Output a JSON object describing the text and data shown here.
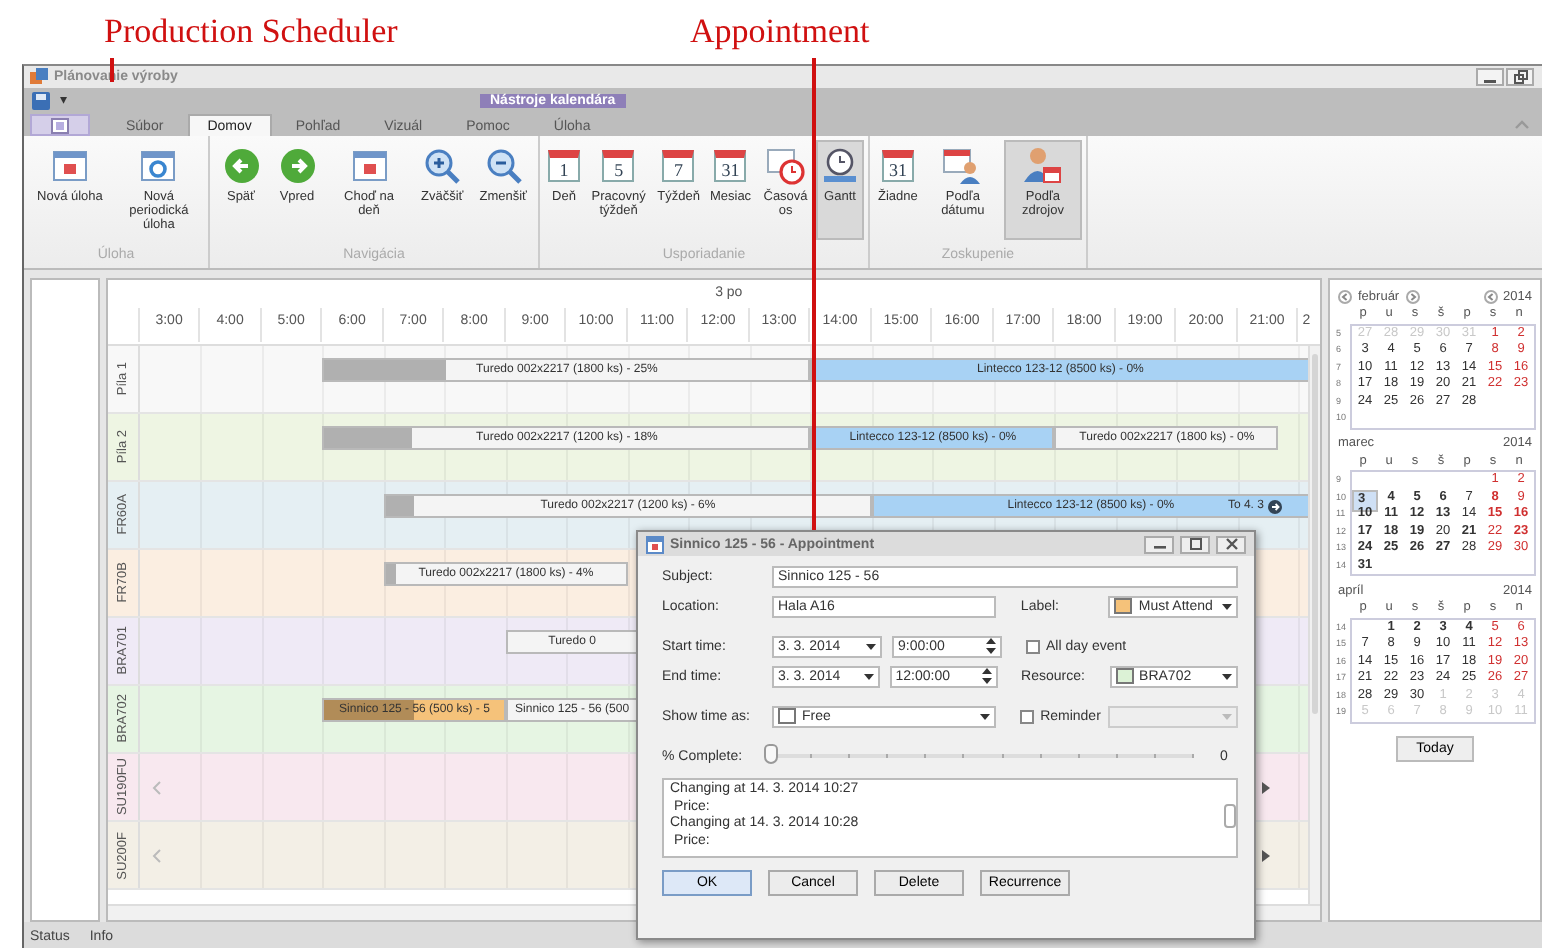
{
  "annotations": [
    {
      "text": "Production Scheduler"
    },
    {
      "text": "Appointment"
    }
  ],
  "window": {
    "title": "Plánovanie výroby",
    "context_title": "Nástroje kalendára",
    "qat_dropdown": "▾"
  },
  "tabs": [
    {
      "label": "Súbor",
      "selected": false
    },
    {
      "label": "Domov",
      "selected": true
    },
    {
      "label": "Pohľad",
      "selected": false
    },
    {
      "label": "Vizuál",
      "selected": false
    },
    {
      "label": "Pomoc",
      "selected": false
    },
    {
      "label": "Úloha",
      "selected": false
    }
  ],
  "ribbon": [
    {
      "label": "Úloha",
      "buttons": [
        {
          "kind": "task",
          "label": "Nová úloha",
          "selected": false
        },
        {
          "kind": "recurring",
          "label": "Nová periodická úloha",
          "selected": false
        }
      ]
    },
    {
      "label": "Navigácia",
      "buttons": [
        {
          "kind": "back",
          "label": "Späť",
          "selected": false
        },
        {
          "kind": "forward",
          "label": "Vpred",
          "selected": false
        },
        {
          "kind": "goto",
          "label": "Choď na deň",
          "selected": false
        },
        {
          "kind": "zoom-in",
          "label": "Zväčšiť",
          "selected": false
        },
        {
          "kind": "zoom-out",
          "label": "Zmenšiť",
          "selected": false
        }
      ]
    },
    {
      "label": "Usporiadanie",
      "buttons": [
        {
          "kind": "calendar",
          "icon_text": "1",
          "label": "Deň",
          "selected": false
        },
        {
          "kind": "calendar",
          "icon_text": "5",
          "label": "Pracovný týždeň",
          "selected": false
        },
        {
          "kind": "calendar",
          "icon_text": "7",
          "label": "Týždeň",
          "selected": false
        },
        {
          "kind": "calendar",
          "icon_text": "31",
          "label": "Mesiac",
          "selected": false
        },
        {
          "kind": "timeline",
          "label": "Časová os",
          "selected": false
        },
        {
          "kind": "gantt",
          "label": "Gantt",
          "selected": true
        }
      ]
    },
    {
      "label": "Zoskupenie",
      "buttons": [
        {
          "kind": "group-none",
          "icon_text": "31",
          "label": "Žiadne",
          "selected": false
        },
        {
          "kind": "group-date",
          "label": "Podľa dátumu",
          "selected": false
        },
        {
          "kind": "group-resource",
          "label": "Podľa zdrojov",
          "selected": true
        }
      ]
    }
  ],
  "scheduler": {
    "day": "3 po",
    "hours": [
      "3:00",
      "4:00",
      "5:00",
      "6:00",
      "7:00",
      "8:00",
      "9:00",
      "10:00",
      "11:00",
      "12:00",
      "13:00",
      "14:00",
      "15:00",
      "16:00",
      "17:00",
      "18:00",
      "19:00",
      "20:00",
      "21:00",
      "2"
    ],
    "rows": [
      {
        "name": "Píla 1",
        "color": "#f8f8f8",
        "overflow": false,
        "bars": [
          {
            "label": "Turedo 002x2217 (1800 ks) - 25%",
            "level": 0.25,
            "color": "#f4f4f4"
          },
          {
            "label": "Lintecco 123-12 (8500 ks) - 0%",
            "color": "#a8d2f4"
          }
        ]
      },
      {
        "name": "Píla 2",
        "color": "#eef5e3",
        "overflow": false,
        "bars": [
          {
            "label": "Turedo 002x2217 (1200 ks) - 18%",
            "level": 0.18,
            "color": "#f4f4f4"
          },
          {
            "label": "Lintecco 123-12 (8500 ks) - 0%",
            "color": "#a8d2f4"
          },
          {
            "label": "Turedo 002x2217 (1800 ks) - 0%",
            "color": "#f4f4f4"
          }
        ]
      },
      {
        "name": "FR60A",
        "color": "#e5eff3",
        "overflow": false,
        "bars": [
          {
            "label": "Turedo 002x2217 (1200 ks) - 6%",
            "level": 0.06,
            "color": "#f4f4f4"
          },
          {
            "label": "Lintecco 123-12 (8500 ks) - 0%",
            "color": "#a8d2f4",
            "continuation": "To 4. 3"
          }
        ]
      },
      {
        "name": "FR70B",
        "color": "#fbeee1",
        "overflow": false,
        "bars": [
          {
            "label": "Turedo 002x2217 (1800 ks) - 4%",
            "level": 0.04,
            "color": "#f4f4f4"
          }
        ]
      },
      {
        "name": "BRA701",
        "color": "#efeaf6",
        "overflow": false,
        "bars": [
          {
            "label": "Turedo 0",
            "color": "#f4f4f4"
          }
        ]
      },
      {
        "name": "BRA702",
        "color": "#e6f5e3",
        "overflow": false,
        "bars": [
          {
            "label": "Sinnico 125 - 56 (500 ks) - 5",
            "level": 0.5,
            "color": "#f5c27a"
          },
          {
            "label": "Sinnico 125 - 56 (500",
            "color": "#f4f4f4"
          }
        ]
      },
      {
        "name": "SU190FU",
        "color": "#f8e8ef",
        "overflow": true
      },
      {
        "name": "SU200F",
        "color": "#f3efe6",
        "overflow": true
      }
    ]
  },
  "dialog": {
    "title": "Sinnico 125 - 56 - Appointment",
    "subject": {
      "label": "Subject:",
      "value": "Sinnico 125 - 56"
    },
    "location": {
      "label": "Location:",
      "value": "Hala A16"
    },
    "label_field": {
      "label": "Label:",
      "value": "Must Attend",
      "color": "#f5c27a"
    },
    "start": {
      "label": "Start time:",
      "date": "3. 3. 2014",
      "time": "9:00:00"
    },
    "end": {
      "label": "End time:",
      "date": "3. 3. 2014",
      "time": "12:00:00"
    },
    "all_day": {
      "label": "All day event",
      "checked": false
    },
    "resource": {
      "label": "Resource:",
      "value": "BRA702",
      "color": "#dcf2d6"
    },
    "show_as": {
      "label": "Show time as:",
      "value": "Free",
      "color": "#ffffff"
    },
    "reminder": {
      "label": "Reminder",
      "checked": false,
      "disabled": true
    },
    "complete": {
      "label": "% Complete:",
      "level": 0,
      "reading": "0"
    },
    "notes": [
      "Changing at 14. 3. 2014 10:27",
      " Price:",
      "Changing at 14. 3. 2014 10:28",
      " Price:"
    ],
    "buttons": [
      {
        "label": "OK",
        "default": true
      },
      {
        "label": "Cancel",
        "default": false
      },
      {
        "label": "Delete",
        "default": false
      },
      {
        "label": "Recurrence",
        "default": false
      }
    ]
  },
  "date_navigator": {
    "today_button": "Today",
    "months": [
      {
        "name": "február",
        "year": "2014",
        "nav": true,
        "weekdays": [
          "p",
          "u",
          "s",
          "š",
          "p",
          "s",
          "n"
        ],
        "weeks": [
          {
            "week": "5",
            "days": [
              {
                "text": "27",
                "muted": true,
                "bold": false,
                "selected": false
              },
              {
                "text": "28",
                "muted": true,
                "bold": false,
                "selected": false
              },
              {
                "text": "29",
                "muted": true,
                "bold": false,
                "selected": false
              },
              {
                "text": "30",
                "muted": true,
                "bold": false,
                "selected": false
              },
              {
                "text": "31",
                "muted": true,
                "bold": false,
                "selected": false
              },
              {
                "text": "1",
                "muted": false,
                "bold": false,
                "selected": false
              },
              {
                "text": "2",
                "muted": false,
                "bold": false,
                "selected": false
              }
            ]
          },
          {
            "week": "6",
            "days": [
              {
                "text": "3",
                "muted": false,
                "bold": false,
                "selected": false
              },
              {
                "text": "4",
                "muted": false,
                "bold": false,
                "selected": false
              },
              {
                "text": "5",
                "muted": false,
                "bold": false,
                "selected": false
              },
              {
                "text": "6",
                "muted": false,
                "bold": false,
                "selected": false
              },
              {
                "text": "7",
                "muted": false,
                "bold": false,
                "selected": false
              },
              {
                "text": "8",
                "muted": false,
                "bold": false,
                "selected": false
              },
              {
                "text": "9",
                "muted": false,
                "bold": false,
                "selected": false
              }
            ]
          },
          {
            "week": "7",
            "days": [
              {
                "text": "10",
                "muted": false,
                "bold": false,
                "selected": false
              },
              {
                "text": "11",
                "muted": false,
                "bold": false,
                "selected": false
              },
              {
                "text": "12",
                "muted": false,
                "bold": false,
                "selected": false
              },
              {
                "text": "13",
                "muted": false,
                "bold": false,
                "selected": false
              },
              {
                "text": "14",
                "muted": false,
                "bold": false,
                "selected": false
              },
              {
                "text": "15",
                "muted": false,
                "bold": false,
                "selected": false
              },
              {
                "text": "16",
                "muted": false,
                "bold": false,
                "selected": false
              }
            ]
          },
          {
            "week": "8",
            "days": [
              {
                "text": "17",
                "muted": false,
                "bold": false,
                "selected": false
              },
              {
                "text": "18",
                "muted": false,
                "bold": false,
                "selected": false
              },
              {
                "text": "19",
                "muted": false,
                "bold": false,
                "selected": false
              },
              {
                "text": "20",
                "muted": false,
                "bold": false,
                "selected": false
              },
              {
                "text": "21",
                "muted": false,
                "bold": false,
                "selected": false
              },
              {
                "text": "22",
                "muted": false,
                "bold": false,
                "selected": false
              },
              {
                "text": "23",
                "muted": false,
                "bold": false,
                "selected": false
              }
            ]
          },
          {
            "week": "9",
            "days": [
              {
                "text": "24",
                "muted": false,
                "bold": false,
                "selected": false
              },
              {
                "text": "25",
                "muted": false,
                "bold": false,
                "selected": false
              },
              {
                "text": "26",
                "muted": false,
                "bold": false,
                "selected": false
              },
              {
                "text": "27",
                "muted": false,
                "bold": false,
                "selected": false
              },
              {
                "text": "28",
                "muted": false,
                "bold": false,
                "selected": false
              }
            ]
          },
          {
            "week": "10"
          }
        ]
      },
      {
        "name": "marec",
        "year": "2014",
        "nav": false,
        "weekdays": [
          "p",
          "u",
          "s",
          "š",
          "p",
          "s",
          "n"
        ],
        "weeks": [
          {
            "week": "9",
            "leading": true,
            "days": [
              {
                "text": "1",
                "muted": false,
                "bold": false,
                "selected": false
              },
              {
                "text": "2",
                "muted": false,
                "bold": false,
                "selected": false
              }
            ]
          },
          {
            "week": "10",
            "days": [
              {
                "text": "3",
                "muted": false,
                "bold": true,
                "selected": true
              },
              {
                "text": "4",
                "muted": false,
                "bold": true,
                "selected": false
              },
              {
                "text": "5",
                "muted": false,
                "bold": true,
                "selected": false
              },
              {
                "text": "6",
                "muted": false,
                "bold": true,
                "selected": false
              },
              {
                "text": "7",
                "muted": false,
                "bold": false,
                "selected": false
              },
              {
                "text": "8",
                "muted": false,
                "bold": true,
                "selected": false
              },
              {
                "text": "9",
                "muted": false,
                "bold": false,
                "selected": false
              }
            ]
          },
          {
            "week": "11",
            "days": [
              {
                "text": "10",
                "muted": false,
                "bold": true,
                "selected": false
              },
              {
                "text": "11",
                "muted": false,
                "bold": true,
                "selected": false
              },
              {
                "text": "12",
                "muted": false,
                "bold": true,
                "selected": false
              },
              {
                "text": "13",
                "muted": false,
                "bold": true,
                "selected": false
              },
              {
                "text": "14",
                "muted": false,
                "bold": false,
                "selected": false
              },
              {
                "text": "15",
                "muted": false,
                "bold": true,
                "selected": false
              },
              {
                "text": "16",
                "muted": false,
                "bold": true,
                "selected": false
              }
            ]
          },
          {
            "week": "12",
            "days": [
              {
                "text": "17",
                "muted": false,
                "bold": true,
                "selected": false
              },
              {
                "text": "18",
                "muted": false,
                "bold": true,
                "selected": false
              },
              {
                "text": "19",
                "muted": false,
                "bold": true,
                "selected": false
              },
              {
                "text": "20",
                "muted": false,
                "bold": false,
                "selected": false
              },
              {
                "text": "21",
                "muted": false,
                "bold": true,
                "selected": false
              },
              {
                "text": "22",
                "muted": false,
                "bold": false,
                "selected": false
              },
              {
                "text": "23",
                "muted": false,
                "bold": true,
                "selected": false
              }
            ]
          },
          {
            "week": "13",
            "days": [
              {
                "text": "24",
                "muted": false,
                "bold": true,
                "selected": false
              },
              {
                "text": "25",
                "muted": false,
                "bold": true,
                "selected": false
              },
              {
                "text": "26",
                "muted": false,
                "bold": true,
                "selected": false
              },
              {
                "text": "27",
                "muted": false,
                "bold": true,
                "selected": false
              },
              {
                "text": "28",
                "muted": false,
                "bold": false,
                "selected": false
              },
              {
                "text": "29",
                "muted": false,
                "bold": false,
                "selected": false
              },
              {
                "text": "30",
                "muted": false,
                "bold": false,
                "selected": false
              }
            ]
          },
          {
            "week": "14",
            "days": [
              {
                "text": "31",
                "muted": false,
                "bold": true,
                "selected": false
              }
            ]
          }
        ]
      },
      {
        "name": "apríl",
        "year": "2014",
        "nav": false,
        "weekdays": [
          "p",
          "u",
          "s",
          "š",
          "p",
          "s",
          "n"
        ],
        "weeks": [
          {
            "week": "14",
            "leading": true,
            "days": [
              {
                "text": "1",
                "muted": false,
                "bold": true,
                "selected": false
              },
              {
                "text": "2",
                "muted": false,
                "bold": true,
                "selected": false
              },
              {
                "text": "3",
                "muted": false,
                "bold": true,
                "selected": false
              },
              {
                "text": "4",
                "muted": false,
                "bold": true,
                "selected": false
              },
              {
                "text": "5",
                "muted": false,
                "bold": false,
                "selected": false
              },
              {
                "text": "6",
                "muted": false,
                "bold": false,
                "selected": false
              }
            ]
          },
          {
            "week": "15",
            "days": [
              {
                "text": "7",
                "muted": false,
                "bold": false,
                "selected": false
              },
              {
                "text": "8",
                "muted": false,
                "bold": false,
                "selected": false
              },
              {
                "text": "9",
                "muted": false,
                "bold": false,
                "selected": false
              },
              {
                "text": "10",
                "muted": false,
                "bold": false,
                "selected": false
              },
              {
                "text": "11",
                "muted": false,
                "bold": false,
                "selected": false
              },
              {
                "text": "12",
                "muted": false,
                "bold": false,
                "selected": false
              },
              {
                "text": "13",
                "muted": false,
                "bold": false,
                "selected": false
              }
            ]
          },
          {
            "week": "16",
            "days": [
              {
                "text": "14",
                "muted": false,
                "bold": false,
                "selected": false
              },
              {
                "text": "15",
                "muted": false,
                "bold": false,
                "selected": false
              },
              {
                "text": "16",
                "muted": false,
                "bold": false,
                "selected": false
              },
              {
                "text": "17",
                "muted": false,
                "bold": false,
                "selected": false
              },
              {
                "text": "18",
                "muted": false,
                "bold": false,
                "selected": false
              },
              {
                "text": "19",
                "muted": false,
                "bold": false,
                "selected": false
              },
              {
                "text": "20",
                "muted": false,
                "bold": false,
                "selected": false
              }
            ]
          },
          {
            "week": "17",
            "days": [
              {
                "text": "21",
                "muted": false,
                "bold": false,
                "selected": false
              },
              {
                "text": "22",
                "muted": false,
                "bold": false,
                "selected": false
              },
              {
                "text": "23",
                "muted": false,
                "bold": false,
                "selected": false
              },
              {
                "text": "24",
                "muted": false,
                "bold": false,
                "selected": false
              },
              {
                "text": "25",
                "muted": false,
                "bold": false,
                "selected": false
              },
              {
                "text": "26",
                "muted": false,
                "bold": false,
                "selected": false
              },
              {
                "text": "27",
                "muted": false,
                "bold": false,
                "selected": false
              }
            ]
          },
          {
            "week": "18",
            "days": [
              {
                "text": "28",
                "muted": false,
                "bold": false,
                "selected": false
              },
              {
                "text": "29",
                "muted": false,
                "bold": false,
                "selected": false
              },
              {
                "text": "30",
                "muted": false,
                "bold": false,
                "selected": false
              },
              {
                "text": "1",
                "muted": true,
                "bold": false,
                "selected": false
              },
              {
                "text": "2",
                "muted": true,
                "bold": false,
                "selected": false
              },
              {
                "text": "3",
                "muted": true,
                "bold": false,
                "selected": false
              },
              {
                "text": "4",
                "muted": true,
                "bold": false,
                "selected": false
              }
            ]
          },
          {
            "week": "19",
            "days": [
              {
                "text": "5",
                "muted": true,
                "bold": false,
                "selected": false
              },
              {
                "text": "6",
                "muted": true,
                "bold": false,
                "selected": false
              },
              {
                "text": "7",
                "muted": true,
                "bold": false,
                "selected": false
              },
              {
                "text": "8",
                "muted": true,
                "bold": false,
                "selected": false
              },
              {
                "text": "9",
                "muted": true,
                "bold": false,
                "selected": false
              },
              {
                "text": "10",
                "muted": true,
                "bold": false,
                "selected": false
              },
              {
                "text": "11",
                "muted": true,
                "bold": false,
                "selected": false
              }
            ]
          }
        ]
      }
    ]
  },
  "status_bar": [
    "Status",
    "Info"
  ]
}
